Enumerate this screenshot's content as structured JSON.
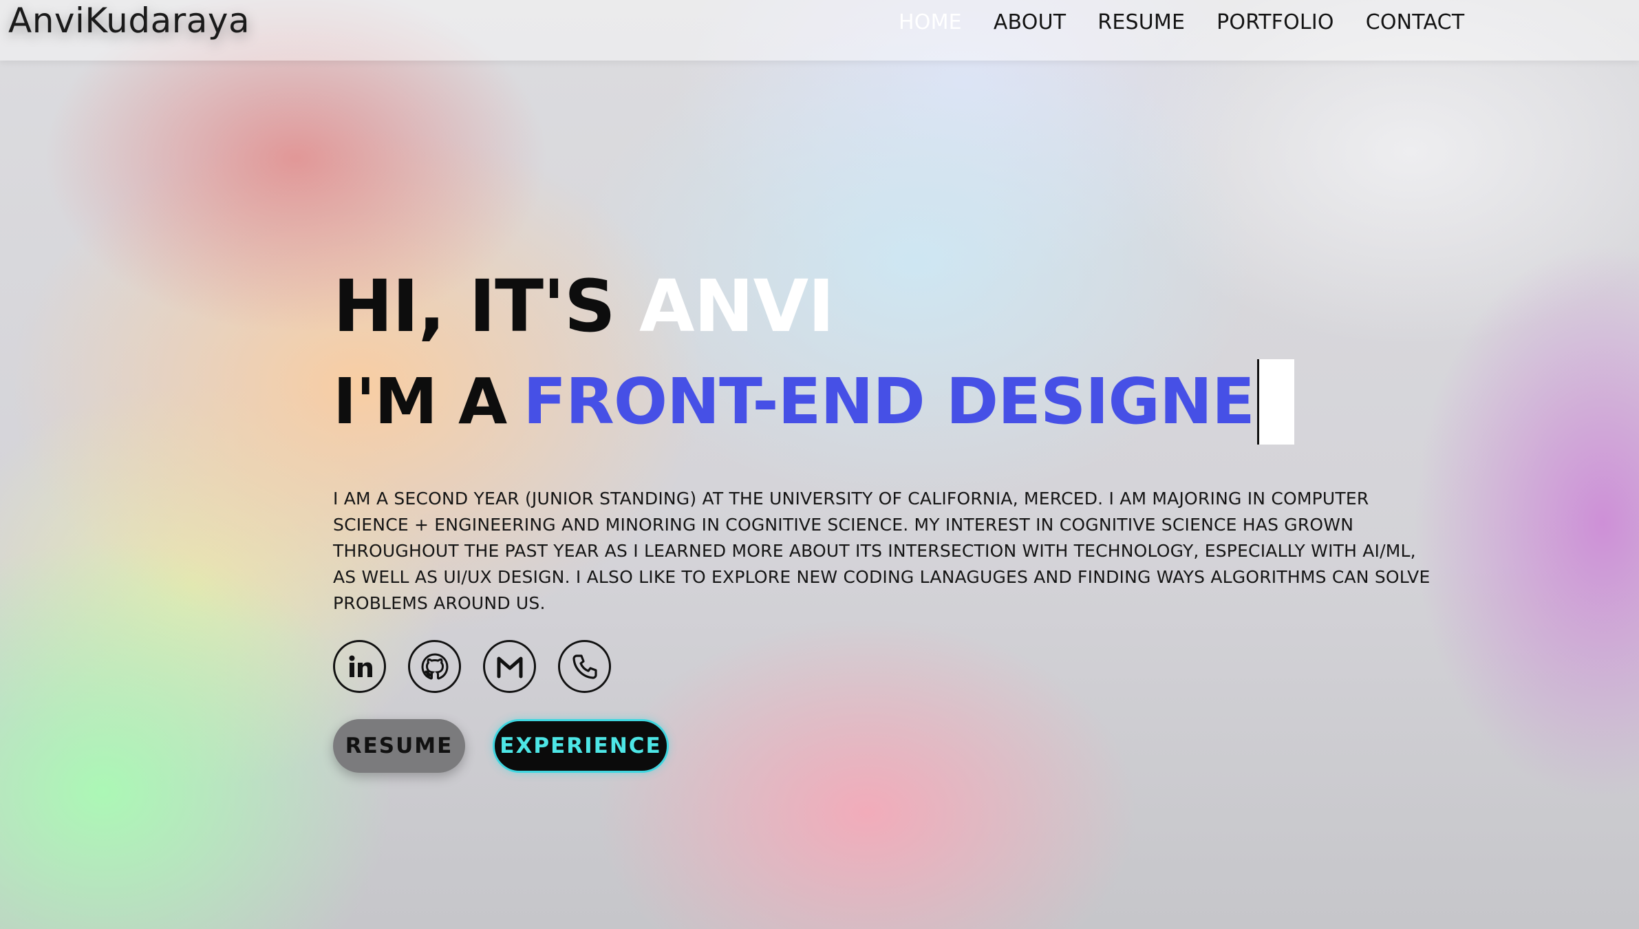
{
  "header": {
    "logo": "AnviKudaraya",
    "nav": [
      {
        "label": "HOME",
        "active": true
      },
      {
        "label": "ABOUT",
        "active": false
      },
      {
        "label": "RESUME",
        "active": false
      },
      {
        "label": "PORTFOLIO",
        "active": false
      },
      {
        "label": "CONTACT",
        "active": false
      }
    ]
  },
  "hero": {
    "greeting_prefix": "HI, IT'S",
    "greeting_name": "ANVI",
    "role_prefix": "I'M A",
    "role_typed": "FRONT-END DESIGNE",
    "bio": "I am a second year (junior standing) at the University of California, Merced. I am majoring in Computer Science + Engineering and minoring in Cognitive Science. My interest in Cognitive Science has grown throughout the past year as I learned more about its intersection with technology, especially with AI/ML, as well as UI/UX design. I also like to explore new coding lanaguges and finding ways algorithms can solve problems around us.",
    "socials": [
      "linkedin-icon",
      "github-icon",
      "gmail-icon",
      "phone-icon"
    ],
    "buttons": {
      "resume": "RESUME",
      "experience": "EXPERIENCE"
    }
  },
  "colors": {
    "accent_blue": "#4650e6",
    "accent_cyan": "#4de6e6",
    "name_white": "#ffffff"
  }
}
